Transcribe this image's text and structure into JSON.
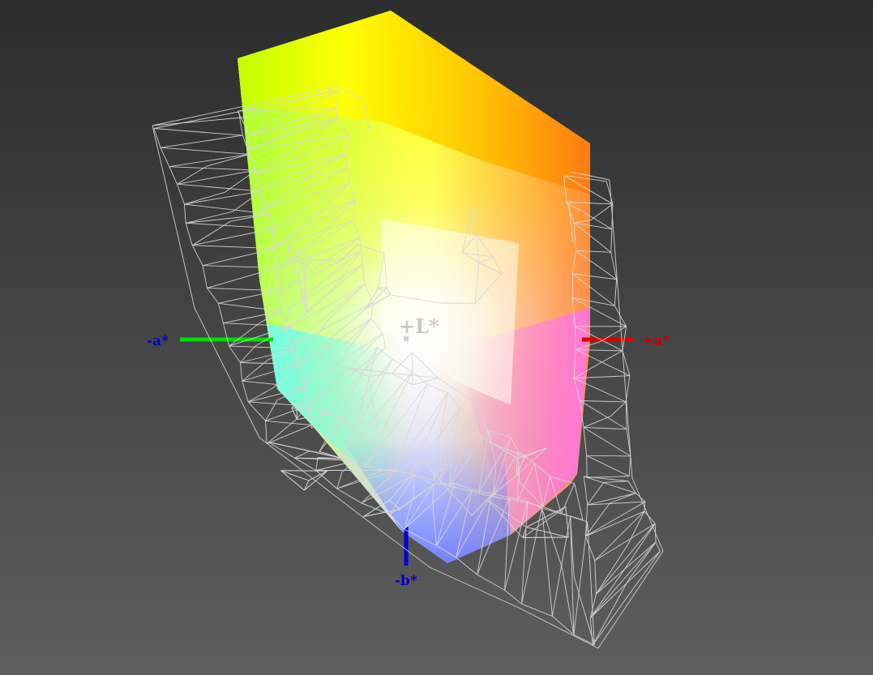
{
  "axes": {
    "neg_a": {
      "label": "-a*",
      "color": "#0000CC"
    },
    "pos_a": {
      "label": "+a*",
      "color": "#CC0000"
    },
    "neg_b": {
      "label": "-b*",
      "color": "#0000CC"
    },
    "pos_l": {
      "label": "+L*",
      "color": "#C8C8C8"
    }
  },
  "colors": {
    "background_top": "#2C2C2C",
    "background_bottom": "#5E5E5E",
    "wireframe": "#D8D8D8",
    "axis_green": "#00DD00",
    "axis_red": "#DD0000",
    "axis_blue": "#0000DD",
    "gamut_yellow": "#FFFF00",
    "gamut_orange": "#FF7F00",
    "gamut_red": "#FF5050",
    "gamut_magenta": "#FF80FF",
    "gamut_blue": "#6060FF",
    "gamut_cyan": "#60FFFF",
    "gamut_green": "#A0FF30",
    "gamut_white": "#FFFFFF"
  }
}
